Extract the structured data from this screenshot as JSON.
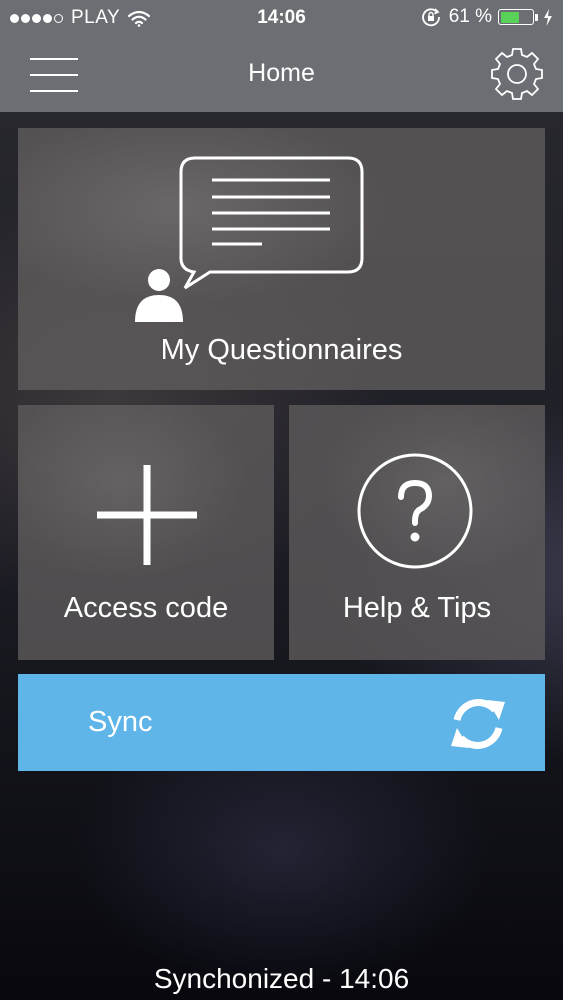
{
  "status_bar": {
    "carrier": "PLAY",
    "time": "14:06",
    "battery_percent": "61 %",
    "battery_level": 0.61,
    "signal_bars": 4,
    "signal_max": 5,
    "icons": [
      "wifi-icon",
      "orientation-lock-icon",
      "battery-icon",
      "charging-bolt-icon"
    ],
    "battery_color": "#5ad25a"
  },
  "nav": {
    "title": "Home",
    "left_icon": "hamburger-menu-icon",
    "right_icon": "gear-icon"
  },
  "tiles": {
    "questionnaires": {
      "label": "My Questionnaires",
      "icon": "chat-bubble-user-icon"
    },
    "access_code": {
      "label": "Access code",
      "icon": "plus-icon"
    },
    "help": {
      "label": "Help & Tips",
      "icon": "question-circle-icon"
    }
  },
  "sync": {
    "label": "Sync",
    "icon": "refresh-icon",
    "color": "#5fb4e8"
  },
  "footer": {
    "status": "Synchonized - 14:06"
  }
}
